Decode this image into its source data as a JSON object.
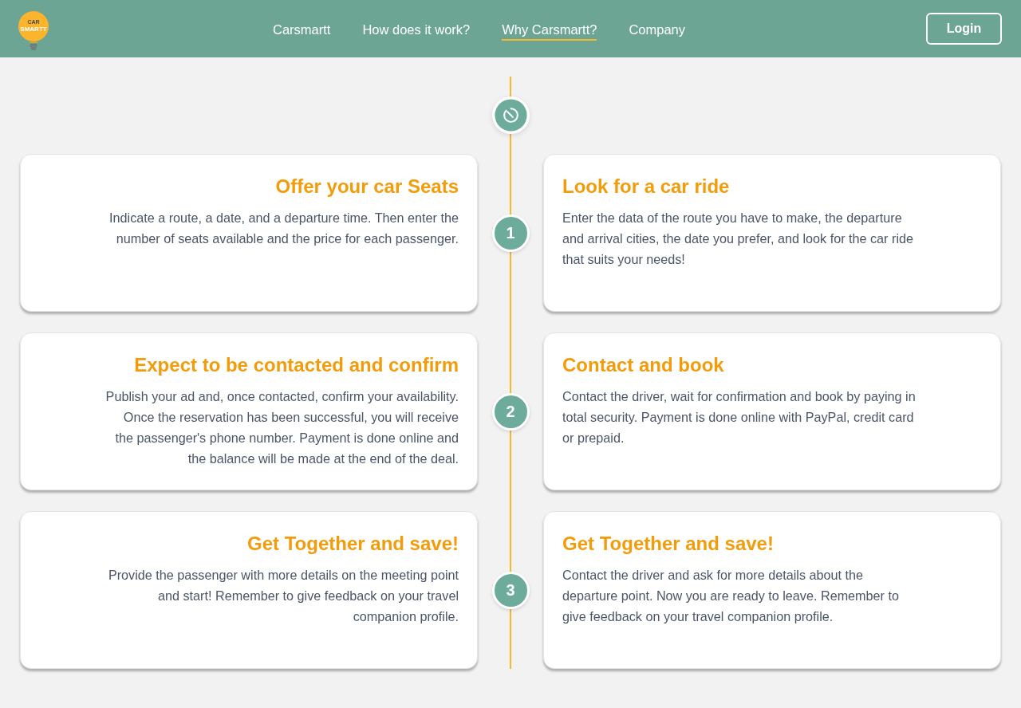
{
  "header": {
    "logo": {
      "small_text": "CAR",
      "main_text": "SMARTT"
    },
    "nav": [
      {
        "label": "Carsmartt",
        "selected": false
      },
      {
        "label": "How does it work?",
        "selected": false
      },
      {
        "label": "Why Carsmartt?",
        "selected": true
      },
      {
        "label": "Company",
        "selected": false
      }
    ],
    "login_button": "Login"
  },
  "timeline": {
    "steps": [
      {
        "number": "1",
        "left_card": {
          "title": "Offer your car Seats",
          "text": "Indicate a route, a date, and a departure time. Then enter the number of seats available and the price for each passenger."
        },
        "right_card": {
          "title": "Look for a car ride",
          "text": "Enter the data of the route you have to make, the departure and arrival cities, the date you prefer, and look for the car ride that suits your needs!"
        }
      },
      {
        "number": "2",
        "left_card": {
          "title": "Expect to be contacted and confirm",
          "text": "Publish your ad and, once contacted, confirm your availability. Once the reservation has been successful, you will receive the passenger's phone number. Payment is done online and the balance will be made at the end of the deal."
        },
        "right_card": {
          "title": "Contact and book",
          "text": "Contact the driver, wait for confirmation and book by paying in total security. Payment is done online with PayPal, credit card or prepaid."
        }
      },
      {
        "number": "3",
        "left_card": {
          "title": "Get Together and save!",
          "text": "Provide the passenger with more details on the meeting point and start! Remember to give feedback on your travel companion profile."
        },
        "right_card": {
          "title": "Get Together and save!",
          "text": "Contact the driver and ask for more details about the departure point. Now you are ready to leave. Remember to give feedback on your travel companion profile."
        }
      }
    ]
  }
}
